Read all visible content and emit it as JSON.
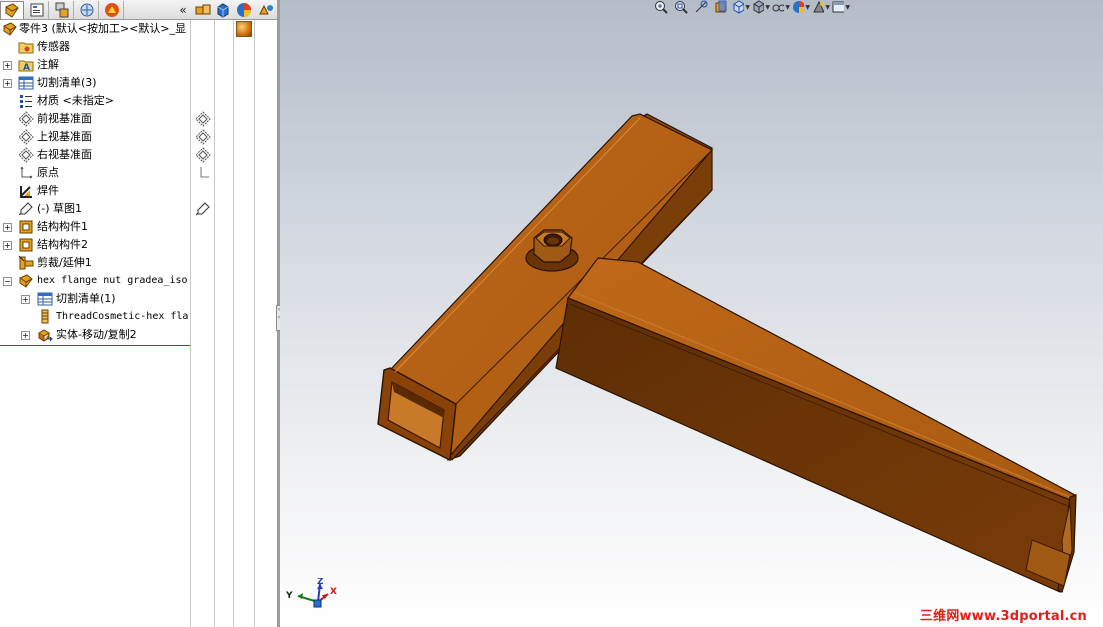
{
  "panel": {
    "tabs": [
      {
        "icon": "feature-manager-icon",
        "active": true
      },
      {
        "icon": "property-manager-icon",
        "active": false
      },
      {
        "icon": "configuration-manager-icon",
        "active": false
      },
      {
        "icon": "dimxpert-icon",
        "active": false
      },
      {
        "icon": "display-manager-icon",
        "active": false
      }
    ],
    "collapse_label": "«",
    "right_tabs": [
      "scene-icon",
      "appearance-cube-icon",
      "appearance-ball-icon",
      "decals-icon"
    ]
  },
  "tree": {
    "root_label": "零件3  (默认<按加工><默认>_显",
    "items": [
      {
        "label": "传感器"
      },
      {
        "label": "注解"
      },
      {
        "label": "切割清单(3)"
      },
      {
        "label": "材质 <未指定>"
      },
      {
        "label": "前视基准面"
      },
      {
        "label": "上视基准面"
      },
      {
        "label": "右视基准面"
      },
      {
        "label": "原点"
      },
      {
        "label": "焊件"
      },
      {
        "label": "(-) 草图1"
      },
      {
        "label": "结构构件1"
      },
      {
        "label": "结构构件2"
      },
      {
        "label": "剪裁/延伸1"
      },
      {
        "label": "hex flange nut gradea_iso"
      },
      {
        "label": "切割清单(1)"
      },
      {
        "label": "ThreadCosmetic-hex fla"
      },
      {
        "label": "实体-移动/复制2"
      }
    ]
  },
  "viewport": {
    "heads_up_toolbar": [
      "zoom-to-fit-icon",
      "zoom-to-area-icon",
      "previous-view-icon",
      "section-view-icon",
      "view-orientation-icon",
      "display-style-icon",
      "hide-show-items-icon",
      "edit-appearance-icon",
      "apply-scene-icon",
      "view-settings-icon"
    ],
    "triad": {
      "x": "X",
      "y": "Y",
      "z": "Z"
    },
    "watermark": "三维网www.3dportal.cn",
    "colors": {
      "part_top": "#b05a0c",
      "part_side": "#8a4208",
      "part_dark": "#5a2a04",
      "part_edge": "#2a1200"
    }
  }
}
